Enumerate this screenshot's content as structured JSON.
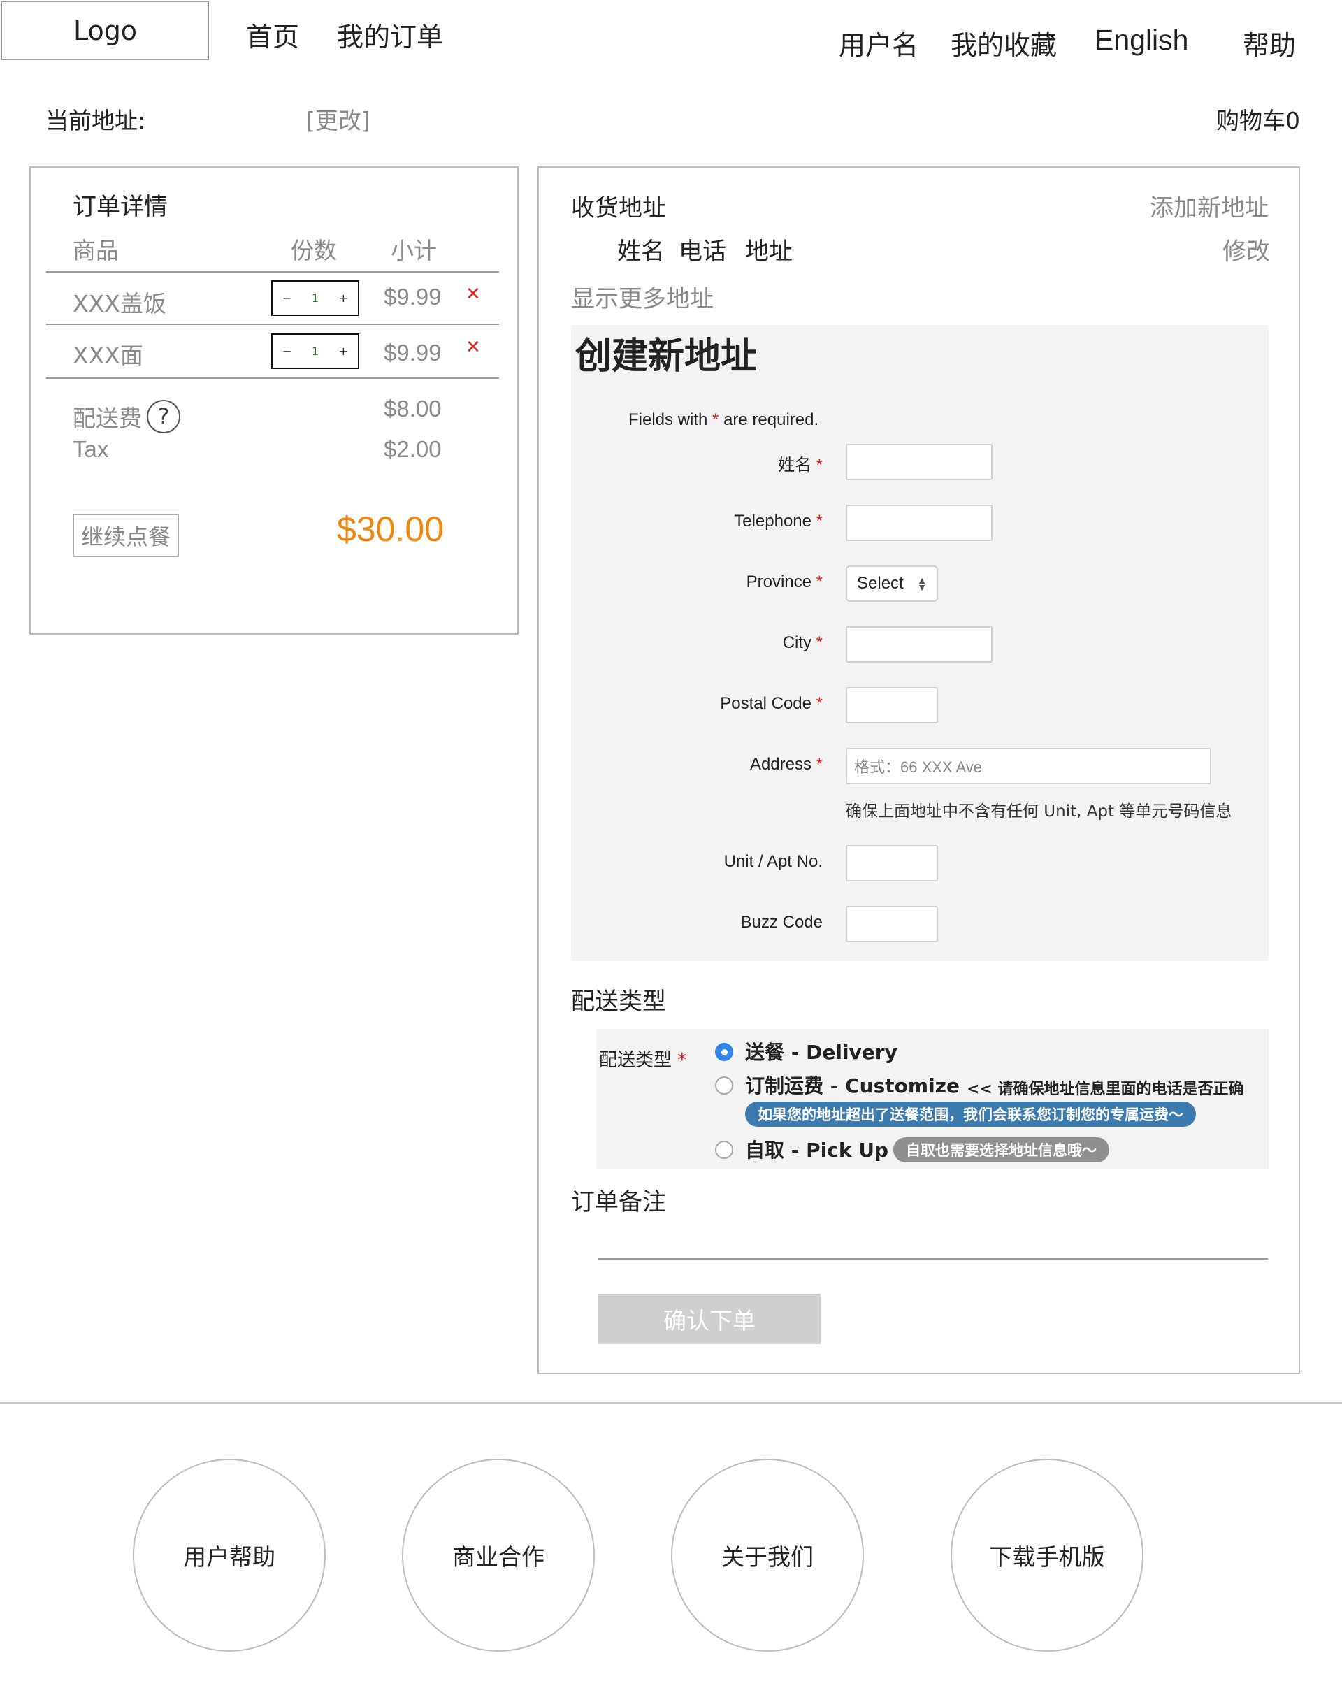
{
  "header": {
    "logo": "Logo",
    "nav_left": [
      "首页",
      "我的订单"
    ],
    "nav_right": [
      "用户名",
      "我的收藏",
      "English",
      "帮助"
    ]
  },
  "address_bar": {
    "label": "当前地址:",
    "change": "[更改]",
    "cart": "购物车0"
  },
  "order": {
    "title": "订单详情",
    "col_item": "商品",
    "col_qty": "份数",
    "col_subtotal": "小计",
    "items": [
      {
        "name": "XXX盖饭",
        "qty": "1",
        "price": "$9.99"
      },
      {
        "name": "XXX面",
        "qty": "1",
        "price": "$9.99"
      }
    ],
    "delivery_label": "配送费",
    "delivery_help": "?",
    "delivery_fee": "$8.00",
    "tax_label": "Tax",
    "tax": "$2.00",
    "continue": "继续点餐",
    "total": "$30.00"
  },
  "shipping": {
    "title": "收货地址",
    "add_new": "添加新地址",
    "col_name": "姓名",
    "col_phone": "电话",
    "col_addr": "地址",
    "edit": "修改",
    "show_more": "显示更多地址"
  },
  "new_address": {
    "title": "创建新地址",
    "required_note_pre": "Fields with",
    "required_note_star": "*",
    "required_note_post": "are required.",
    "fields": {
      "name": "姓名",
      "telephone": "Telephone",
      "province": "Province",
      "city": "City",
      "postal": "Postal Code",
      "address": "Address",
      "unit": "Unit / Apt No.",
      "buzz": "Buzz Code"
    },
    "province_value": "Select",
    "address_placeholder": "格式：66 XXX Ave",
    "address_hint": "确保上面地址中不含有任何 Unit, Apt 等单元号码信息"
  },
  "delivery_type": {
    "section_title": "配送类型",
    "label": "配送类型",
    "options": [
      {
        "label": "送餐 - Delivery",
        "selected": true
      },
      {
        "label": "订制运费 - Customize",
        "selected": false
      },
      {
        "label": "自取 - Pick Up",
        "selected": false
      }
    ],
    "customize_note": "<< 请确保地址信息里面的电话是否正确",
    "customize_pill": "如果您的地址超出了送餐范围，我们会联系您订制您的专属运费～",
    "pickup_pill": "自取也需要选择地址信息哦～",
    "colors": {
      "blue_pill": "#3b7bb0",
      "gray_pill": "#8f8f8f"
    }
  },
  "notes": {
    "title": "订单备注"
  },
  "submit": "确认下单",
  "footer": [
    "用户帮助",
    "商业合作",
    "关于我们",
    "下载手机版"
  ],
  "colors": {
    "accent_total": "#f0860e",
    "remove": "#e02020",
    "radio": "#2f86e8"
  }
}
